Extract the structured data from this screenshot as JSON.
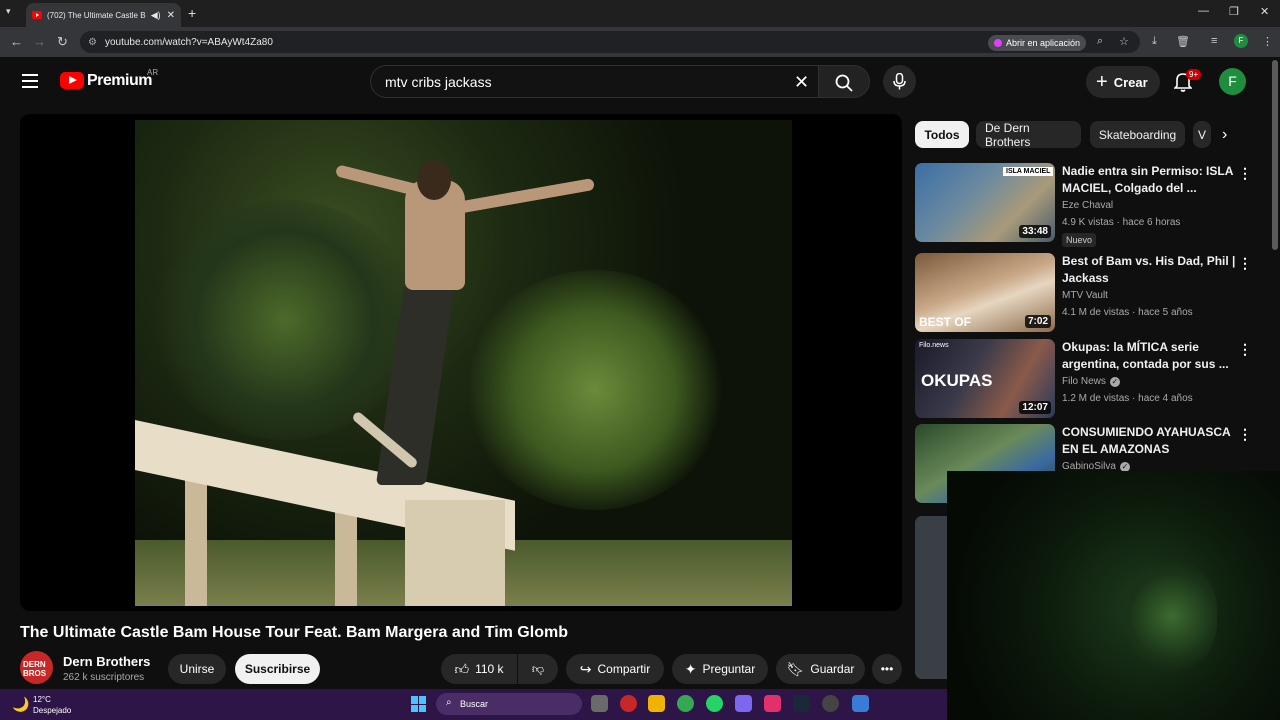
{
  "browser": {
    "tab_title": "(702) The Ultimate Castle B",
    "tab_audio_icon": "speaker-icon",
    "new_tab": "+",
    "url": "youtube.com/watch?v=ABAyWt4Za80",
    "open_in_app": "Abrir en aplicación",
    "profile_initial": "F",
    "colors": {
      "tabbar": "#1f1f1f",
      "toolbar": "#35363a",
      "omnibox": "#202124"
    }
  },
  "header": {
    "logo_text": "Premium",
    "region": "AR",
    "search_value": "mtv cribs jackass",
    "create_label": "Crear",
    "notif_count": "9+",
    "avatar_initial": "F"
  },
  "video": {
    "title": "The Ultimate Castle Bam House Tour Feat. Bam Margera and Tim Glomb",
    "channel": {
      "name": "Dern Brothers",
      "subs": "262 k suscriptores",
      "avatar_text": "DERN BROS"
    },
    "actions": {
      "join": "Unirse",
      "subscribe": "Suscribirse",
      "likes": "110 k",
      "share": "Compartir",
      "ask": "Preguntar",
      "save": "Guardar"
    }
  },
  "chips": [
    "Todos",
    "De Dern Brothers",
    "Skateboarding",
    "V"
  ],
  "recommendations": [
    {
      "title": "Nadie entra sin Permiso: ISLA MACIEL, Colgado del ...",
      "channel": "Eze Chaval",
      "meta": "4.9 K vistas · hace 6 horas",
      "badge": "Nuevo",
      "duration": "33:48",
      "thumb_label": "ISLA MACIEL"
    },
    {
      "title": "Best of Bam vs. His Dad, Phil | Jackass",
      "channel": "MTV Vault",
      "meta": "4.1 M de vistas · hace 5 años",
      "duration": "7:02",
      "thumb_label": "BEST OF"
    },
    {
      "title": "Okupas: la MÍTICA serie argentina, contada por sus ...",
      "channel": "Filo News",
      "meta": "1.2 M de vistas · hace 4 años",
      "duration": "12:07",
      "thumb_label": "OKUPAS",
      "thumb_sub": "Filo.news"
    },
    {
      "title": "CONSUMIENDO AYAHUASCA EN EL AMAZONAS",
      "channel": "GabinoSilva"
    }
  ],
  "taskbar": {
    "temp": "12°C",
    "weather": "Despejado",
    "search_placeholder": "Buscar"
  }
}
